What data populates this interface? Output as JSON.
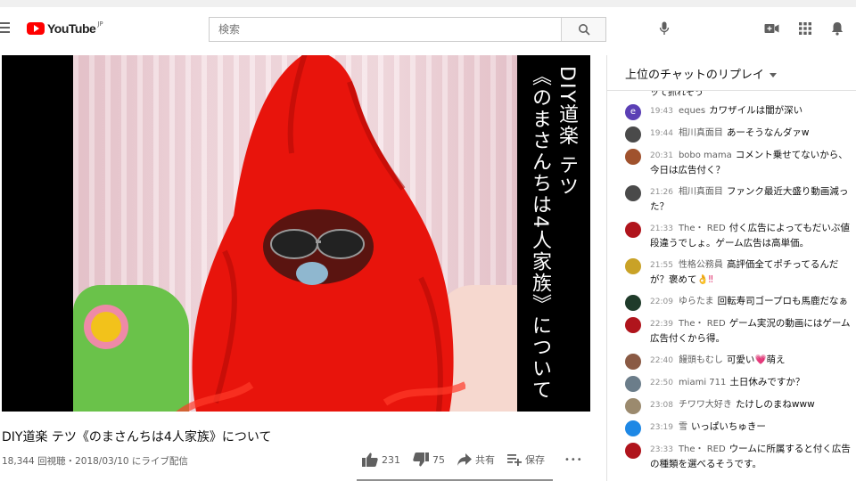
{
  "header": {
    "logo_text": "YouTube",
    "logo_region": "JP",
    "search_placeholder": "検索"
  },
  "video": {
    "caption_line1": "DIY道楽 テツ",
    "caption_line2": "《のまさんちは4人家族》について",
    "title": "DIY道楽 テツ《のまさんちは4人家族》について",
    "meta": "18,344 回視聴・2018/03/10 にライブ配信",
    "likes": "231",
    "dislikes": "75",
    "share_label": "共有",
    "save_label": "保存",
    "more_label": "•••"
  },
  "chat": {
    "header_label": "上位のチャットのリプレイ",
    "partial_text": "ッて抓れそう",
    "messages": [
      {
        "time": "19:43",
        "author": "eques",
        "text": "カワザイルは闇が深い",
        "avatar_color": "#5b3fb5",
        "avatar_letter": "e"
      },
      {
        "time": "19:44",
        "author": "相川真面目",
        "text": "あーそうなんダァw",
        "avatar_color": "#4a4a4a",
        "avatar_letter": ""
      },
      {
        "time": "20:31",
        "author": "bobo mama",
        "text": "コメント乗せてないから、今日は広告付く？",
        "avatar_color": "#a0522d",
        "avatar_letter": ""
      },
      {
        "time": "21:26",
        "author": "相川真面目",
        "text": "ファンク最近大盛り動画減った？",
        "avatar_color": "#4a4a4a",
        "avatar_letter": ""
      },
      {
        "time": "21:33",
        "author": "The・ RED",
        "text": "付く広告によってもだいぶ値段違うでしょ。ゲーム広告は高単価。",
        "avatar_color": "#b0141c",
        "avatar_letter": ""
      },
      {
        "time": "21:55",
        "author": "性格公務員",
        "text": "高評価全てポチってるんだが？褒めて",
        "emoji": "👌‼",
        "avatar_color": "#c9a227",
        "avatar_letter": ""
      },
      {
        "time": "22:09",
        "author": "ゆらたま",
        "text": "回転寿司ゴープロも馬鹿だなぁ",
        "avatar_color": "#1f3b2a",
        "avatar_letter": ""
      },
      {
        "time": "22:39",
        "author": "The・ RED",
        "text": "ゲーム実況の動画にはゲーム広告付くから得。",
        "avatar_color": "#b0141c",
        "avatar_letter": ""
      },
      {
        "time": "22:40",
        "author": "饅頭もむし",
        "text": "可愛い",
        "emoji": "💗",
        "text2": "萌え",
        "avatar_color": "#8a5a44",
        "avatar_letter": ""
      },
      {
        "time": "22:50",
        "author": "miami 711",
        "text": "土日休みですか？",
        "avatar_color": "#6b7d8a",
        "avatar_letter": ""
      },
      {
        "time": "23:08",
        "author": "チワワ大好き",
        "text": "たけしのまねwww",
        "avatar_color": "#9b8a6e",
        "avatar_letter": ""
      },
      {
        "time": "23:19",
        "author": "雪",
        "text": "いっぱいちゅきー",
        "avatar_color": "#1e88e5",
        "avatar_letter": ""
      },
      {
        "time": "23:33",
        "author": "The・ RED",
        "text": "ウームに所属すると付く広告の種類を選べるそうです。",
        "avatar_color": "#b0141c",
        "avatar_letter": ""
      }
    ]
  }
}
